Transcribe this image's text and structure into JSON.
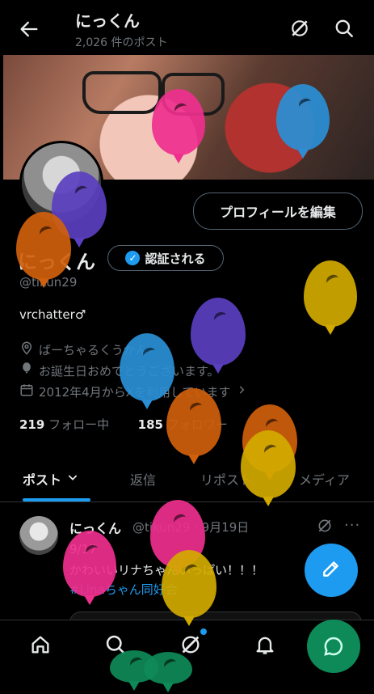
{
  "header": {
    "name": "にっくん",
    "post_count": "2,026 件のポスト"
  },
  "profile": {
    "edit_label": "プロフィールを編集",
    "display_name": "にっくん",
    "verify_label": "認証される",
    "handle": "@tikun29",
    "bio": "vrchatter♂",
    "location": "ばーちゃるくうかん",
    "birthday": "お誕生日おめでとうございます。",
    "joined": "2012年4月からXを利用しています",
    "following_count": "219",
    "following_label": "フォロー中",
    "followers_count": "185",
    "followers_label": "フォロワー"
  },
  "tabs": [
    {
      "label": "ポスト"
    },
    {
      "label": "返信"
    },
    {
      "label": "リポスト"
    },
    {
      "label": "メディア"
    }
  ],
  "post": {
    "name": "にっくん",
    "handle_date": "@tikun29 · 9月19日",
    "line1": "9/17",
    "line2": "かわいいリナちゃんいっぱい！！！",
    "hashtag": "#Linaちゃん同好会"
  },
  "colors": {
    "accent": "#1d9bf0",
    "balloon_pink": "#ef2f8e",
    "balloon_blue": "#2a8fd6",
    "balloon_purple": "#5a3fc0",
    "balloon_orange": "#d0600c",
    "balloon_yellow": "#d2aa00",
    "balloon_green": "#0e8a58"
  },
  "icons": [
    "back-arrow-icon",
    "grok-icon",
    "search-icon",
    "location-icon",
    "balloon-icon",
    "calendar-icon",
    "chevron-right-icon",
    "chevron-down-icon",
    "more-icon",
    "compose-icon",
    "home-icon",
    "notifications-icon",
    "messages-icon"
  ]
}
